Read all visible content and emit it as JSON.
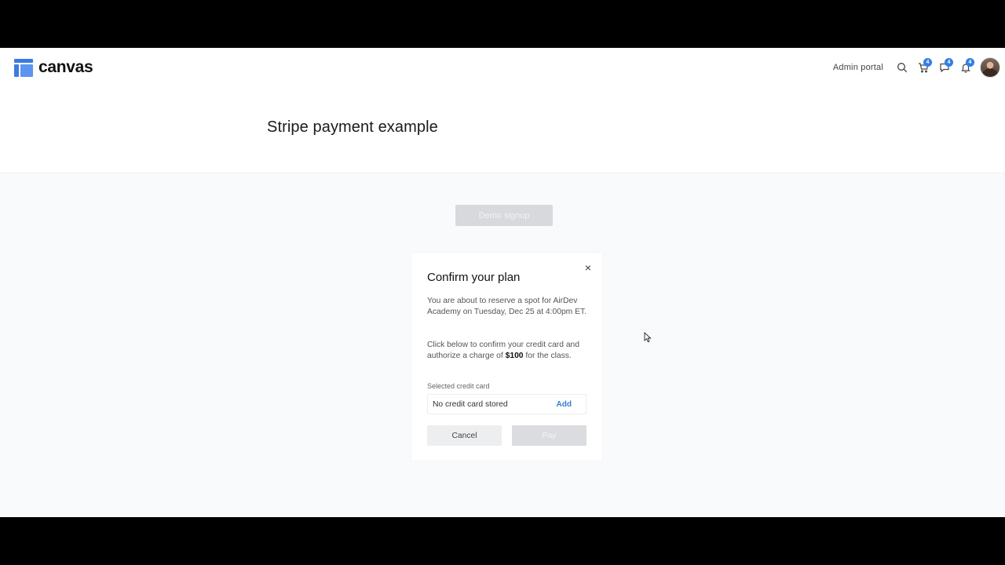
{
  "header": {
    "logo_text": "canvas",
    "admin_link": "Admin portal",
    "badges": {
      "cart": "4",
      "messages": "4",
      "notifications": "4"
    }
  },
  "page": {
    "title": "Stripe payment example",
    "demo_button": "Demo signup"
  },
  "modal": {
    "title": "Confirm your plan",
    "close_glyph": "×",
    "paragraph1": "You are about to reserve a spot for AirDev Academy on Tuesday, Dec 25 at 4:00pm ET.",
    "paragraph2_before": "Click below to confirm your credit card and authorize a charge of ",
    "amount": "$100",
    "paragraph2_after": " for the class.",
    "card_label": "Selected credit card",
    "card_value": "No credit card stored",
    "add_label": "Add",
    "cancel_label": "Cancel",
    "pay_label": "Pay"
  },
  "colors": {
    "accent": "#2f7ef0",
    "logo_blue": "#3b7be8",
    "disabled_button": "#d7d9dd",
    "page_background": "#f9fafb"
  }
}
